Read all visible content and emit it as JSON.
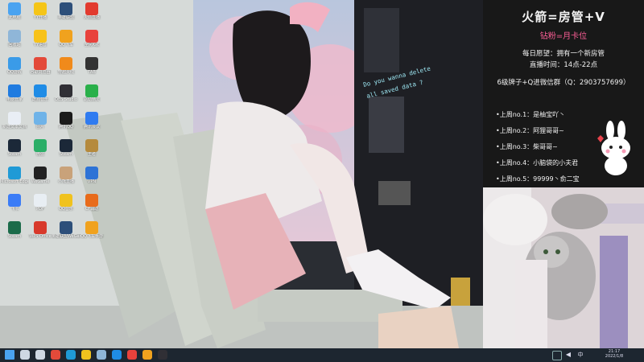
{
  "desktop_icons": [
    {
      "label": "此电脑",
      "icon": "computer-icon",
      "color": "#4aa3f0"
    },
    {
      "label": "YY开播",
      "icon": "yy-icon",
      "color": "#f5c518"
    },
    {
      "label": "英雄联盟",
      "icon": "lol-icon",
      "color": "#2d4f7a"
    },
    {
      "label": "火箭直播",
      "icon": "rocket-icon",
      "color": "#e23b2f"
    },
    {
      "label": "回收站",
      "icon": "recycle-bin-icon",
      "color": "#8fb6d8"
    },
    {
      "label": "YY语音",
      "icon": "yy-voice-icon",
      "color": "#f7c21a"
    },
    {
      "label": "QQ飞车",
      "icon": "qq-speed-icon",
      "color": "#f0a21e"
    },
    {
      "label": "全民K歌",
      "icon": "kge-icon",
      "color": "#e8423c"
    },
    {
      "label": "QQ游戏",
      "icon": "qq-game-icon",
      "color": "#3a9be8"
    },
    {
      "label": "谷歌浏览器",
      "icon": "chrome-icon",
      "color": "#e34a3a"
    },
    {
      "label": "穿越火线",
      "icon": "cf-icon",
      "color": "#f08a1b"
    },
    {
      "label": "TAB",
      "icon": "tab-icon",
      "color": "#333333"
    },
    {
      "label": "电脑管家",
      "icon": "pc-manager-icon",
      "color": "#1f7be0"
    },
    {
      "label": "酷狗音乐",
      "icon": "kugou-icon",
      "color": "#1f8ce6"
    },
    {
      "label": "OBS Studio",
      "icon": "obs-icon",
      "color": "#302f35"
    },
    {
      "label": "驱动精灵",
      "icon": "driver-icon",
      "color": "#2ab04a"
    },
    {
      "label": "新建文本文档",
      "icon": "text-file-icon",
      "color": "#e9eef5"
    },
    {
      "label": "图片",
      "icon": "picture-icon",
      "color": "#6fb3e8"
    },
    {
      "label": "腾讯QQ",
      "icon": "qq-icon",
      "color": "#1b1b1b"
    },
    {
      "label": "腾讯会议",
      "icon": "meeting-icon",
      "color": "#2f7bf0"
    },
    {
      "label": "Steam",
      "icon": "steam-icon",
      "color": "#1b2838"
    },
    {
      "label": "微信",
      "icon": "wechat-icon",
      "color": "#2aae67"
    },
    {
      "label": "Steam",
      "icon": "steam-icon",
      "color": "#1b2838"
    },
    {
      "label": "王者",
      "icon": "game-icon",
      "color": "#b58a3c"
    },
    {
      "label": "Microsoft Edge",
      "icon": "edge-icon",
      "color": "#1f9ad6"
    },
    {
      "label": "WeGame",
      "icon": "wegame-icon",
      "color": "#222222"
    },
    {
      "label": "小熊直播",
      "icon": "bear-icon",
      "color": "#c9a27a"
    },
    {
      "label": "VPN",
      "icon": "vpn-icon",
      "color": "#2d73d6"
    },
    {
      "label": "飞书",
      "icon": "feishu-icon",
      "color": "#3b7cf6"
    },
    {
      "label": "PDF",
      "icon": "pdf-icon",
      "color": "#e8eef3"
    },
    {
      "label": "QQ音乐",
      "icon": "qq-music-icon",
      "color": "#f0c21e"
    },
    {
      "label": "CF辅助",
      "icon": "cf2-icon",
      "color": "#e86b1b"
    },
    {
      "label": "Steam",
      "icon": "steam-icon",
      "color": "#1b6b4a"
    },
    {
      "label": "WPS Office",
      "icon": "wps-icon",
      "color": "#d8392b"
    },
    {
      "label": "英雄联盟WeGame版",
      "icon": "lol-wegame-icon",
      "color": "#2d4f7a"
    },
    {
      "label": "QQ飞车手游",
      "icon": "qq-speed2-icon",
      "color": "#f0a21e"
    }
  ],
  "wallpaper": {
    "glitch_text": "Do you wanna delete all saved data ?"
  },
  "panel": {
    "title": "火箭=房管+V",
    "subtitle": "钻粉=月卡位",
    "line1": "每日愿望：拥有一个新房管",
    "line2": "直播时间：14点-22点",
    "line3": "6级牌子+Q进微信群（Q：2903757699）",
    "rank": [
      "•上周no.1：是柚宝吖丶",
      "•上周no.2：阿狸哥哥~",
      "•上周no.3：柴哥哥~",
      "•上周no.4：小脑袋的小夫君",
      "•上周no.5：99999丶俞二宝"
    ],
    "accent": "#ff5f98"
  },
  "taskbar": {
    "time": "21:17",
    "date": "2022/1/8",
    "icons": [
      "windows-start-icon",
      "search-icon",
      "task-view-icon",
      "chrome-icon",
      "edge-icon",
      "file-explorer-icon",
      "send-icon",
      "kugou-icon",
      "app-icon",
      "app-icon",
      "obs-icon"
    ]
  }
}
